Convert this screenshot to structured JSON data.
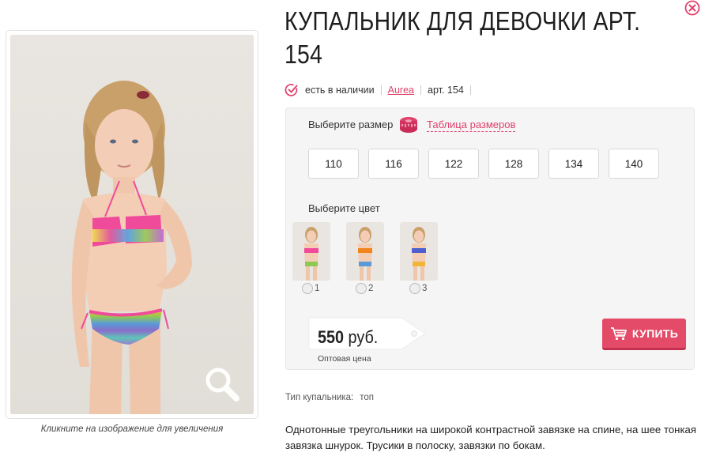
{
  "product": {
    "title": "КУПАЛЬНИК ДЛЯ ДЕВОЧКИ АРТ. 154",
    "availability": "есть в наличии",
    "brand": "Aurea",
    "article": "арт. 154"
  },
  "gallery": {
    "caption": "Кликните на изображение для увеличения"
  },
  "options": {
    "size_label": "Выберите размер",
    "size_table_label": "Таблица размеров",
    "sizes": [
      "110",
      "116",
      "122",
      "128",
      "134",
      "140"
    ],
    "color_label": "Выберите цвет",
    "colors": [
      {
        "label": "1",
        "accent": "#f04a9a"
      },
      {
        "label": "2",
        "accent": "#f0861c"
      },
      {
        "label": "3",
        "accent": "#4f5fd0"
      }
    ]
  },
  "price": {
    "amount": "550",
    "currency": "руб.",
    "note": "Оптовая цена"
  },
  "buy_label": "КУПИТЬ",
  "specs": {
    "type_label": "Тип купальника:",
    "type_value": "топ"
  },
  "description": "Однотонные треугольники на широкой контрастной завязке на спине, на шее тонкая завязка шнурок. Трусики в полоску, завязки по бокам.",
  "colors": {
    "accent": "#e0416c",
    "buy_button": "#e44b68",
    "panel_bg": "#f5f5f5"
  }
}
